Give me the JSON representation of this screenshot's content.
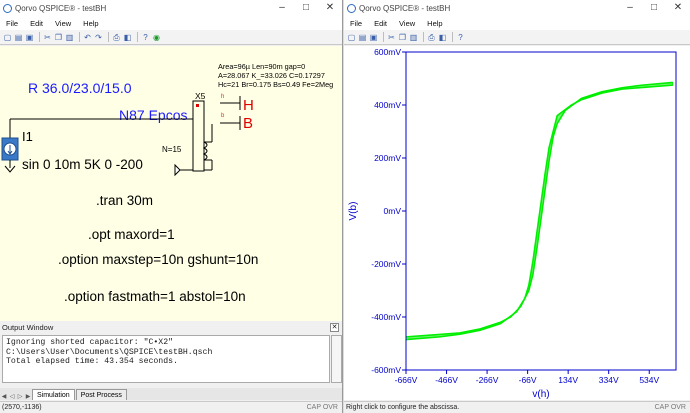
{
  "left_window": {
    "title": "Qorvo QSPICE® - testBH",
    "menu": [
      "File",
      "Edit",
      "View",
      "Help"
    ],
    "schematic": {
      "r_label": "R 36.0/23.0/15.0",
      "core_name": "N87 Epcos",
      "part_ref": "X5",
      "core_params_line1": "Area=96µ Len=90m gap=0",
      "core_params_line2": "A=28.067  K_=33.026 C=0.17297",
      "core_params_line3": "Hc=21 Br=0.175 Bs=0.49  Fe=2Meg",
      "turns": "N=15",
      "port_h_small": "h",
      "port_h": "H",
      "port_b_small": "b",
      "port_b": "B",
      "source_ref": "I1",
      "source_value": "sin 0 10m 5K 0 -200",
      "tran": ".tran  30m",
      "opt1": ".opt maxord=1",
      "opt2": ".option maxstep=10n gshunt=10n",
      "opt3": ".option fastmath=1  abstol=10n"
    },
    "output_window": {
      "title": "Output Window",
      "lines": [
        "Ignoring shorted capacitor: \"C•X2\"",
        "C:\\Users\\User\\Documents\\QSPICE\\testBH.qsch",
        "",
        "Total elapsed time: 43.354 seconds."
      ],
      "tabs": [
        "Simulation",
        "Post Process"
      ]
    },
    "status": {
      "left": "(2570,-1136)",
      "right": "CAP  OVR"
    }
  },
  "right_window": {
    "title": "Qorvo QSPICE® - testBH",
    "menu": [
      "File",
      "Edit",
      "View",
      "Help"
    ],
    "status": {
      "left": "Right click to configure the abscissa.",
      "right": "CAP  OVR"
    }
  },
  "colors": {
    "trace": "#00ee00",
    "axis": "#0000cc",
    "schematic_bg": "#ffffe6",
    "label_blue": "#1a1aff",
    "label_red": "#e00000"
  },
  "chart_data": {
    "type": "line",
    "xlabel": "v(h)",
    "ylabel": "V(b)",
    "x_ticks": [
      "-666V",
      "-466V",
      "-266V",
      "-66V",
      "134V",
      "334V",
      "534V"
    ],
    "y_ticks": [
      "600mV",
      "400mV",
      "200mV",
      "0mV",
      "-200mV",
      "-400mV",
      "-600mV"
    ],
    "xlim": [
      -666,
      666
    ],
    "ylim": [
      -0.6,
      0.6
    ],
    "grid": false,
    "series": [
      {
        "x": [
          -666,
          -400,
          -300,
          -200,
          -150,
          -100,
          -60,
          -40,
          -20,
          0,
          20,
          40,
          60,
          80,
          120,
          200,
          300,
          400,
          500,
          650
        ],
        "y": [
          -0.475,
          -0.46,
          -0.445,
          -0.42,
          -0.4,
          -0.36,
          -0.3,
          -0.24,
          -0.14,
          -0.03,
          0.08,
          0.19,
          0.28,
          0.33,
          0.38,
          0.425,
          0.45,
          0.465,
          0.475,
          0.485
        ]
      },
      {
        "x": [
          -666,
          -500,
          -400,
          -300,
          -200,
          -120,
          -80,
          -60,
          -40,
          -20,
          0,
          20,
          40,
          80,
          150,
          200,
          300,
          400,
          650
        ],
        "y": [
          -0.485,
          -0.475,
          -0.465,
          -0.45,
          -0.425,
          -0.38,
          -0.33,
          -0.28,
          -0.19,
          -0.08,
          0.03,
          0.14,
          0.24,
          0.36,
          0.4,
          0.42,
          0.445,
          0.46,
          0.475
        ]
      }
    ]
  }
}
